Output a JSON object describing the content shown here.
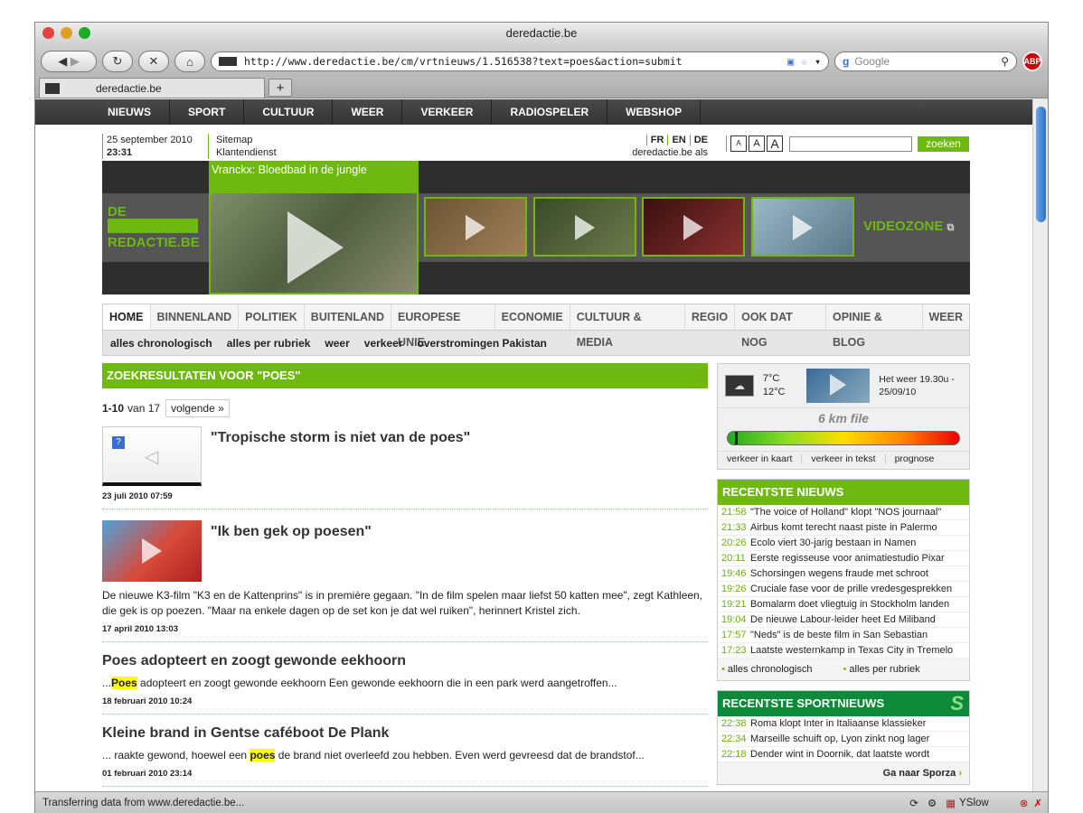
{
  "window": {
    "title": "deredactie.be",
    "tab_label": "deredactie.be",
    "url": "http://www.deredactie.be/cm/vrtnieuws/1.516538?text=poes&action=submit",
    "search_placeholder": "Google",
    "abp": "ABP",
    "status": "Transferring data from www.deredactie.be...",
    "yslow": "YSlow"
  },
  "topnav": [
    "NIEUWS",
    "SPORT",
    "CULTUUR",
    "WEER",
    "VERKEER",
    "RADIOSPELER",
    "WEBSHOP"
  ],
  "util": {
    "date": "25 september 2010",
    "time": "23:31",
    "sitemap": "Sitemap",
    "klantendienst": "Klantendienst",
    "lang": [
      "FR",
      "EN",
      "DE"
    ],
    "startpage": "deredactie.be als startpagina",
    "font_sizes": [
      "A",
      "A",
      "A"
    ],
    "search_button": "zoeken"
  },
  "video": {
    "logo_line1": "DE",
    "logo_line2": "REDACTIE.BE",
    "featured_title": "Vranckx: Bloedbad in de jungle",
    "videozone": "VIDEOZONE"
  },
  "tabs": [
    "HOME",
    "BINNENLAND",
    "POLITIEK",
    "BUITENLAND",
    "EUROPESE UNIE",
    "ECONOMIE",
    "CULTUUR & MEDIA",
    "REGIO",
    "OOK DAT NOG",
    "OPINIE & BLOG",
    "WEER"
  ],
  "subtabs": [
    "alles chronologisch",
    "alles per rubriek",
    "weer",
    "verkeer",
    "overstromingen Pakistan"
  ],
  "results": {
    "heading": "ZOEKRESULTATEN VOOR \"POES\"",
    "range": "1-10",
    "van": "van 17",
    "next": "volgende »",
    "items": [
      {
        "title": "\"Tropische storm is niet van de poes\"",
        "date": "23 juli 2010 07:59"
      },
      {
        "title": "\"Ik ben gek op poesen\"",
        "text": "De nieuwe K3-film \"K3 en de Kattenprins\" is in première gegaan. \"In de film spelen maar liefst 50 katten mee\", zegt Kathleen, die gek is op poezen. \"Maar na enkele dagen op de set kon je dat wel ruiken\", herinnert Kristel zich.",
        "date": "17 april 2010 13:03"
      },
      {
        "title": "Poes adopteert en zoogt gewonde eekhoorn",
        "pre": "...",
        "hl": "Poes",
        "post": " adopteert en zoogt gewonde eekhoorn Een gewonde eekhoorn die in een park werd aangetroffen...",
        "date": "18 februari 2010 10:24"
      },
      {
        "title": "Kleine brand in Gentse caféboot De Plank",
        "pre": "... raakte gewond, hoewel een ",
        "hl": "poes",
        "post": " de brand niet overleefd zou hebben. Even werd gevreesd dat de brandstof...",
        "date": "01 februari 2010 23:14"
      }
    ]
  },
  "weather": {
    "temp_low": "7°C",
    "temp_high": "12°C",
    "caption": "Het weer 19.30u - 25/09/10",
    "file": "6 km file",
    "traffic_level": 0.03,
    "links": [
      "verkeer in kaart",
      "verkeer in tekst",
      "prognose"
    ]
  },
  "news": {
    "heading": "RECENTSTE NIEUWS",
    "items": [
      {
        "time": "21:58",
        "text": "\"The voice of Holland\" klopt \"NOS journaal\""
      },
      {
        "time": "21:33",
        "text": "Airbus komt terecht naast piste in Palermo"
      },
      {
        "time": "20:26",
        "text": "Ecolo viert 30-jarig bestaan in Namen"
      },
      {
        "time": "20:11",
        "text": "Eerste regisseuse voor animatiestudio Pixar"
      },
      {
        "time": "19:46",
        "text": "Schorsingen wegens fraude met schroot"
      },
      {
        "time": "19:26",
        "text": "Cruciale fase voor de prille vredesgesprekken"
      },
      {
        "time": "19:21",
        "text": "Bomalarm doet vliegtuig in Stockholm landen"
      },
      {
        "time": "19:04",
        "text": "De nieuwe Labour-leider heet Ed Miliband"
      },
      {
        "time": "17:57",
        "text": "\"Neds\" is de beste film in San Sebastian"
      },
      {
        "time": "17:23",
        "text": "Laatste westernkamp in Texas City in Tremelo"
      }
    ],
    "links": [
      "alles chronologisch",
      "alles per rubriek"
    ]
  },
  "sport": {
    "heading": "RECENTSTE SPORTNIEUWS",
    "items": [
      {
        "time": "22:38",
        "text": "Roma klopt Inter in Italiaanse klassieker"
      },
      {
        "time": "22:34",
        "text": "Marseille schuift op, Lyon zinkt nog lager"
      },
      {
        "time": "22:18",
        "text": "Dender wint in Doornik, dat laatste wordt"
      }
    ],
    "more": "Ga naar Sporza"
  }
}
